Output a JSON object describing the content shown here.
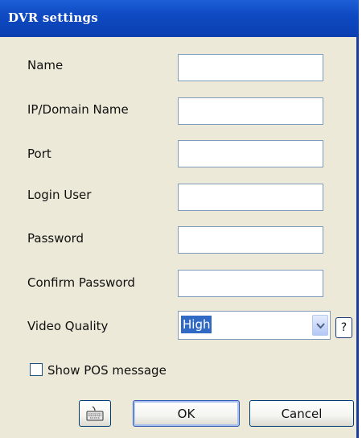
{
  "window": {
    "title": "DVR settings"
  },
  "form": {
    "name_label": "Name",
    "name_value": "",
    "ip_label": "IP/Domain Name",
    "ip_value": "",
    "port_label": "Port",
    "port_value": "",
    "user_label": "Login User",
    "user_value": "",
    "password_label": "Password",
    "password_value": "",
    "confirm_label": "Confirm Password",
    "confirm_value": "",
    "quality_label": "Video Quality",
    "quality_value": "High",
    "help_label": "?",
    "pos_label": "Show POS message",
    "pos_checked": false
  },
  "buttons": {
    "keyboard_icon": "keyboard-icon",
    "ok": "OK",
    "cancel": "Cancel"
  },
  "colors": {
    "titlebar": "#0f4ac2",
    "selection": "#316ac5",
    "dialog_bg": "#ece9d8"
  }
}
